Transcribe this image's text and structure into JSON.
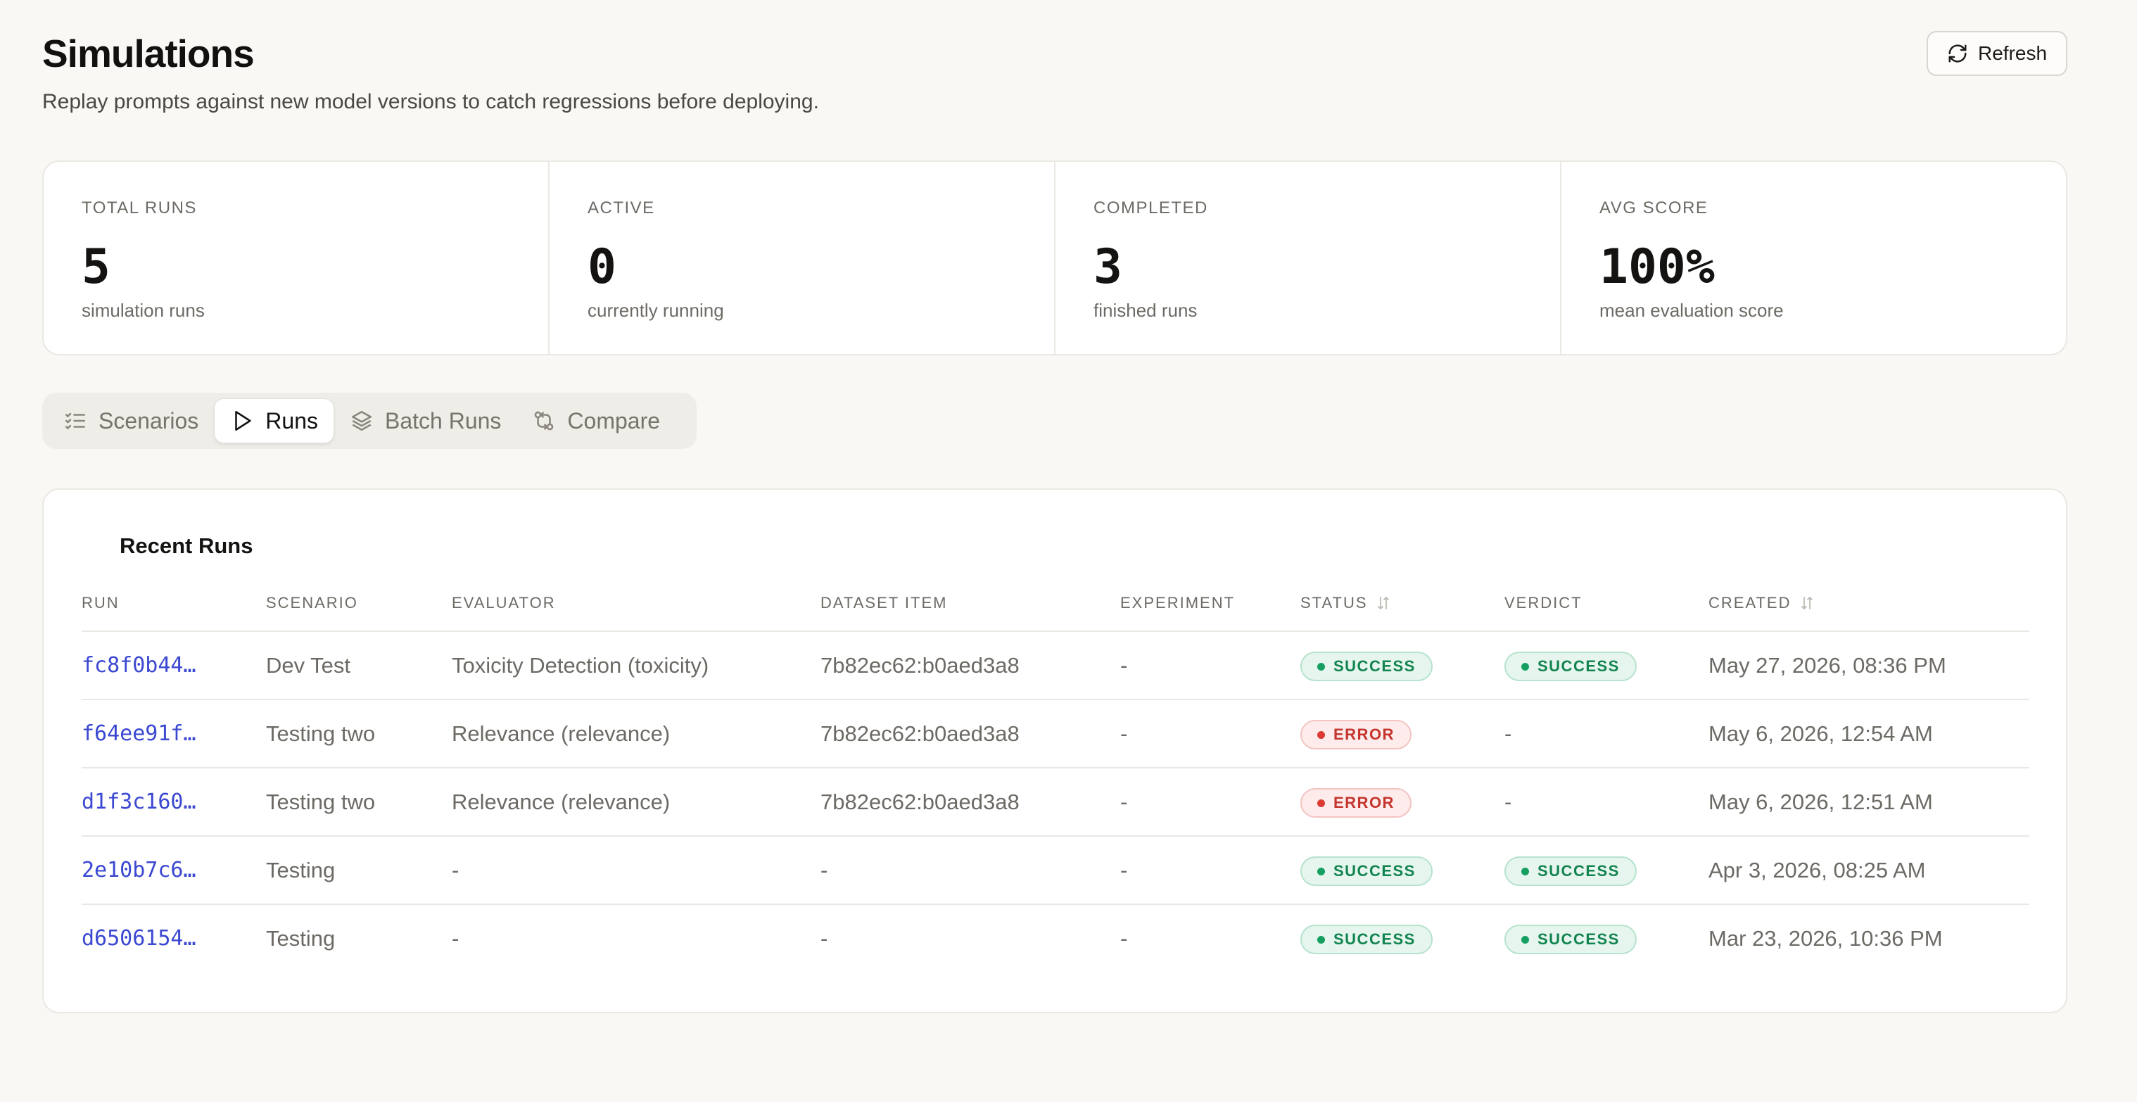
{
  "header": {
    "title": "Simulations",
    "subtitle": "Replay prompts against new model versions to catch regressions before deploying.",
    "refresh_label": "Refresh"
  },
  "stats": [
    {
      "label": "TOTAL RUNS",
      "value": "5",
      "desc": "simulation runs"
    },
    {
      "label": "ACTIVE",
      "value": "0",
      "desc": "currently running"
    },
    {
      "label": "COMPLETED",
      "value": "3",
      "desc": "finished runs"
    },
    {
      "label": "AVG SCORE",
      "value": "100%",
      "desc": "mean evaluation score"
    }
  ],
  "tabs": [
    {
      "label": "Scenarios",
      "icon": "list-checks-icon",
      "active": false
    },
    {
      "label": "Runs",
      "icon": "play-icon",
      "active": true
    },
    {
      "label": "Batch Runs",
      "icon": "layers-icon",
      "active": false
    },
    {
      "label": "Compare",
      "icon": "git-compare-icon",
      "active": false
    }
  ],
  "runs": {
    "title": "Recent Runs",
    "columns": {
      "run": "RUN",
      "scenario": "SCENARIO",
      "evaluator": "EVALUATOR",
      "dataset_item": "DATASET ITEM",
      "experiment": "EXPERIMENT",
      "status": "STATUS",
      "verdict": "VERDICT",
      "created": "CREATED"
    },
    "rows": [
      {
        "run": "fc8f0b44…",
        "scenario": "Dev Test",
        "evaluator": "Toxicity Detection (toxicity)",
        "dataset_item": "7b82ec62:b0aed3a8",
        "experiment": "-",
        "status": "SUCCESS",
        "verdict": "SUCCESS",
        "created": "May 27, 2026, 08:36 PM"
      },
      {
        "run": "f64ee91f…",
        "scenario": "Testing two",
        "evaluator": "Relevance (relevance)",
        "dataset_item": "7b82ec62:b0aed3a8",
        "experiment": "-",
        "status": "ERROR",
        "verdict": "-",
        "created": "May 6, 2026, 12:54 AM"
      },
      {
        "run": "d1f3c160…",
        "scenario": "Testing two",
        "evaluator": "Relevance (relevance)",
        "dataset_item": "7b82ec62:b0aed3a8",
        "experiment": "-",
        "status": "ERROR",
        "verdict": "-",
        "created": "May 6, 2026, 12:51 AM"
      },
      {
        "run": "2e10b7c6…",
        "scenario": "Testing",
        "evaluator": "-",
        "dataset_item": "-",
        "experiment": "-",
        "status": "SUCCESS",
        "verdict": "SUCCESS",
        "created": "Apr 3, 2026, 08:25 AM"
      },
      {
        "run": "d6506154…",
        "scenario": "Testing",
        "evaluator": "-",
        "dataset_item": "-",
        "experiment": "-",
        "status": "SUCCESS",
        "verdict": "SUCCESS",
        "created": "Mar 23, 2026, 10:36 PM"
      }
    ]
  }
}
